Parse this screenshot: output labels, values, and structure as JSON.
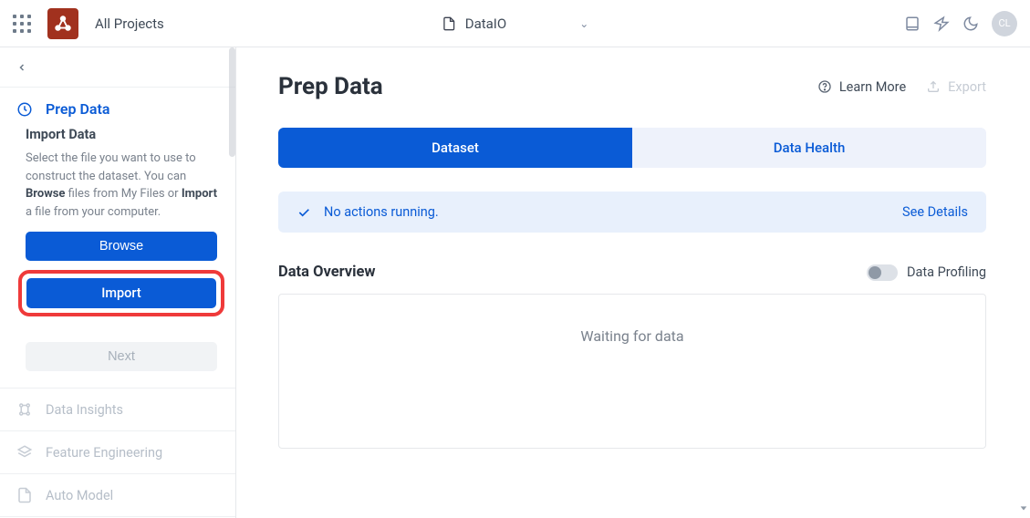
{
  "topnav": {
    "all_projects_label": "All Projects",
    "project_name": "DataIO",
    "avatar_initials": "CL"
  },
  "sidebar": {
    "active_step_label": "Prep Data",
    "section_title": "Import Data",
    "help_line1": "Select the file you want to use to construct the dataset. You can",
    "help_browse": "Browse",
    "help_mid": " files from My Files or ",
    "help_import": "Import",
    "help_line2": " a file from your computer.",
    "browse_btn": "Browse",
    "import_btn": "Import",
    "next_btn": "Next",
    "nav_items": [
      {
        "label": "Data Insights"
      },
      {
        "label": "Feature Engineering"
      },
      {
        "label": "Auto Model"
      }
    ]
  },
  "main": {
    "title": "Prep Data",
    "learn_more": "Learn More",
    "export": "Export",
    "tabs": {
      "dataset": "Dataset",
      "health": "Data Health"
    },
    "status_text": "No actions running.",
    "see_details": "See Details",
    "overview_title": "Data Overview",
    "profiling_label": "Data Profiling",
    "waiting": "Waiting for data"
  }
}
